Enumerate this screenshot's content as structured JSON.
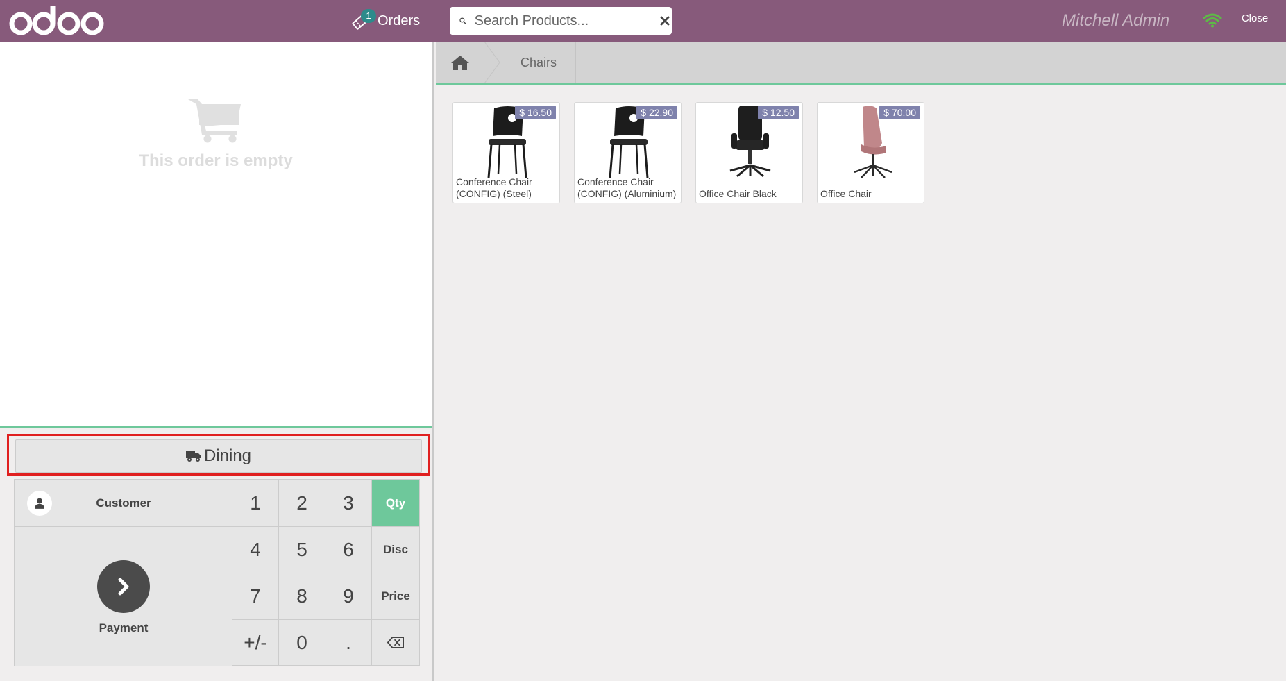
{
  "header": {
    "logo_text": "odoo",
    "orders_label": "Orders",
    "orders_count": "1",
    "search_placeholder": "Search Products...",
    "user_name": "Mitchell Admin",
    "close_label": "Close"
  },
  "order": {
    "empty_text": "This order is empty"
  },
  "dining_label": "Dining",
  "numpad": {
    "customer_label": "Customer",
    "payment_label": "Payment",
    "keys": [
      "1",
      "2",
      "3",
      "Qty",
      "4",
      "5",
      "6",
      "Disc",
      "7",
      "8",
      "9",
      "Price",
      "+/-",
      "0",
      ".",
      "⌫"
    ]
  },
  "breadcrumb": {
    "category": "Chairs"
  },
  "products": [
    {
      "name": "Conference Chair (CONFIG) (Steel)",
      "price": "$ 16.50"
    },
    {
      "name": "Conference Chair (CONFIG) (Aluminium)",
      "price": "$ 22.90"
    },
    {
      "name": "Office Chair Black",
      "price": "$ 12.50"
    },
    {
      "name": "Office Chair",
      "price": "$ 70.00"
    }
  ],
  "colors": {
    "brand": "#875a7b",
    "accent": "#6ec89b",
    "price_badge": "#7f82ac",
    "highlight": "#e01f1f"
  }
}
